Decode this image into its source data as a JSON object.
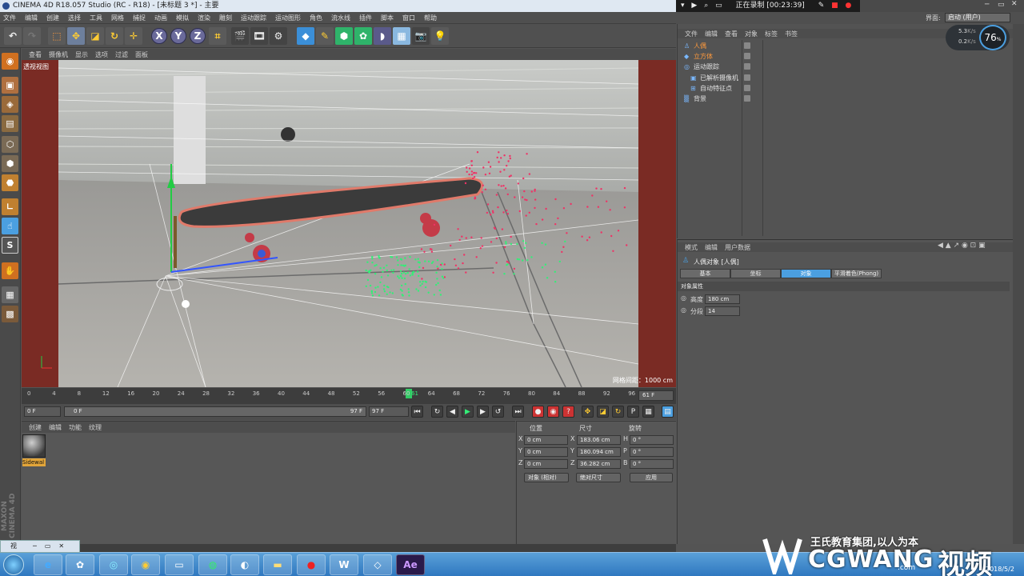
{
  "window": {
    "title": "CINEMA 4D R18.057 Studio (RC - R18) - [未标题 3 *] - 主要"
  },
  "recorder": {
    "status": "正在录制 [00:23:39]"
  },
  "menu": [
    "文件",
    "编辑",
    "创建",
    "选择",
    "工具",
    "网格",
    "捕捉",
    "动画",
    "模拟",
    "渲染",
    "雕刻",
    "运动跟踪",
    "运动图形",
    "角色",
    "流水线",
    "插件",
    "脚本",
    "窗口",
    "帮助"
  ],
  "layout": {
    "label": "界面:",
    "value": "启动 (用户)"
  },
  "perf": {
    "up": "5.3",
    "down": "0.2",
    "up_unit": "K/s",
    "down_unit": "K/s",
    "percent": "76"
  },
  "viewport": {
    "menu": [
      "查看",
      "摄像机",
      "显示",
      "选项",
      "过滤",
      "面板"
    ],
    "label": "透视视图",
    "grid_size": "网格间距：1000 cm"
  },
  "timeline": {
    "ticks": [
      "0",
      "4",
      "8",
      "12",
      "16",
      "20",
      "24",
      "28",
      "32",
      "36",
      "40",
      "44",
      "48",
      "52",
      "56",
      "60",
      "64",
      "68",
      "72",
      "76",
      "80",
      "84",
      "88",
      "92",
      "96"
    ],
    "current": "61",
    "end": "61 F"
  },
  "transport": {
    "start": "0 F",
    "range_start": "0 F",
    "range_end": "97 F",
    "end": "97 F"
  },
  "materials": {
    "menu": [
      "创建",
      "编辑",
      "功能",
      "纹理"
    ],
    "items": [
      {
        "name": "Sidewal"
      }
    ]
  },
  "coords": {
    "headers": [
      "位置",
      "尺寸",
      "旋转"
    ],
    "rows": [
      {
        "axis": "X",
        "pos": "0 cm",
        "size_axis": "X",
        "size": "183.06 cm",
        "rot_axis": "H",
        "rot": "0 °"
      },
      {
        "axis": "Y",
        "pos": "0 cm",
        "size_axis": "Y",
        "size": "180.094 cm",
        "rot_axis": "P",
        "rot": "0 °"
      },
      {
        "axis": "Z",
        "pos": "0 cm",
        "size_axis": "Z",
        "size": "36.282 cm",
        "rot_axis": "B",
        "rot": "0 °"
      }
    ],
    "mode": "对象 (相对)",
    "size_mode": "绝对尺寸",
    "apply": "应用"
  },
  "objects": {
    "menu": [
      "文件",
      "编辑",
      "查看",
      "对象",
      "标签",
      "书签"
    ],
    "items": [
      {
        "name": "人偶",
        "color": "#ff9a3c"
      },
      {
        "name": "立方体",
        "color": "#ff9a3c"
      },
      {
        "name": "运动跟踪",
        "color": "#e0e0e0"
      },
      {
        "name": "已解析摄像机",
        "color": "#e0e0e0"
      },
      {
        "name": "自动特征点",
        "color": "#e0e0e0"
      },
      {
        "name": "背景",
        "color": "#e0e0e0"
      }
    ]
  },
  "attributes": {
    "menu": [
      "模式",
      "编辑",
      "用户数据"
    ],
    "title": "人偶对象 [人偶]",
    "tabs": [
      "基本",
      "坐标",
      "对象",
      "平滑着色(Phong)"
    ],
    "active_tab": "对象",
    "section": "对象属性",
    "params": [
      {
        "label": "高度",
        "value": "180 cm"
      },
      {
        "label": "分段",
        "value": "14"
      }
    ]
  },
  "watermark": {
    "line1": "王氏教育集团,以人为本",
    "logo": "CGWANG",
    "logo_cn": "视频",
    "date": "2018/5/2",
    "domain": ".com"
  },
  "taskbar": {
    "small_window": "视"
  },
  "colors": {
    "accent": "#4b9fe0",
    "selected_material": "#e2a53a",
    "viewport_border": "#7a2b24",
    "tracker_green": "#33ee77",
    "tracker_red": "#ee3366"
  }
}
